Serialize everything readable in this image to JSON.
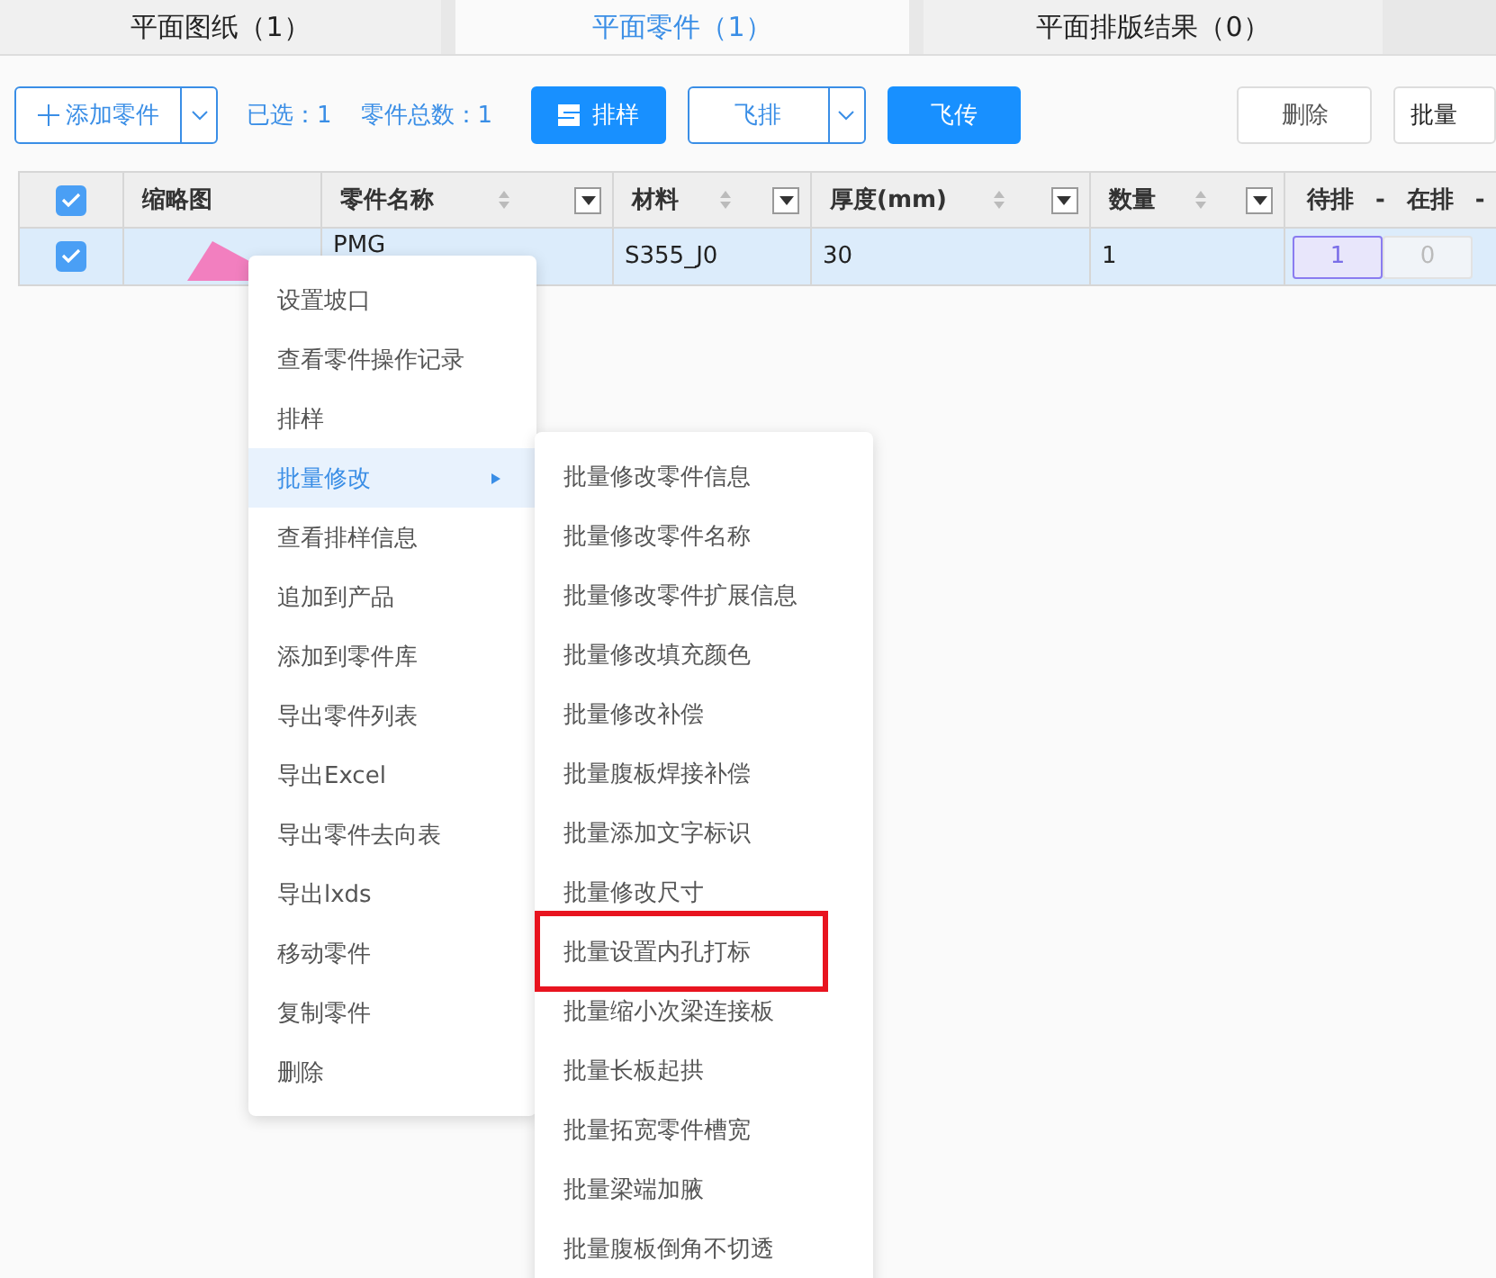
{
  "tabs": [
    {
      "label": "平面图纸（1）",
      "selected": false
    },
    {
      "label": "平面零件（1）",
      "selected": true
    },
    {
      "label": "平面排版结果（0）",
      "selected": false
    }
  ],
  "toolbar": {
    "add_part": "添加零件",
    "selected_count": "已选：1",
    "total_count": "零件总数：1",
    "nest": "排样",
    "fly_nest": "飞排",
    "fly_send": "飞传",
    "delete": "删除",
    "batch": "批量"
  },
  "table": {
    "header_checked": true,
    "columns": [
      {
        "label": "缩略图",
        "sortable": false
      },
      {
        "label": "零件名称",
        "sortable": true
      },
      {
        "label": "材料",
        "sortable": true
      },
      {
        "label": "厚度(mm)",
        "sortable": true
      },
      {
        "label": "数量",
        "sortable": true
      }
    ],
    "status_columns": [
      "待排",
      "-",
      "在排",
      "-"
    ],
    "rows": [
      {
        "checked": true,
        "selected": true,
        "name": "PMG",
        "material": "S355_J0",
        "thickness": "30",
        "quantity": "1",
        "pending": "1",
        "in_progress": "0"
      }
    ]
  },
  "context_menu": [
    {
      "label": "设置坡口",
      "selected": false,
      "submenu": false
    },
    {
      "label": "查看零件操作记录",
      "selected": false,
      "submenu": false
    },
    {
      "label": "排样",
      "selected": false,
      "submenu": false
    },
    {
      "label": "批量修改",
      "selected": true,
      "submenu": true
    },
    {
      "label": "查看排样信息",
      "selected": false,
      "submenu": false
    },
    {
      "label": "追加到产品",
      "selected": false,
      "submenu": false
    },
    {
      "label": "添加到零件库",
      "selected": false,
      "submenu": false
    },
    {
      "label": "导出零件列表",
      "selected": false,
      "submenu": false
    },
    {
      "label": "导出Excel",
      "selected": false,
      "submenu": false
    },
    {
      "label": "导出零件去向表",
      "selected": false,
      "submenu": false
    },
    {
      "label": "导出lxds",
      "selected": false,
      "submenu": false
    },
    {
      "label": "移动零件",
      "selected": false,
      "submenu": false
    },
    {
      "label": "复制零件",
      "selected": false,
      "submenu": false
    },
    {
      "label": "删除",
      "selected": false,
      "submenu": false
    }
  ],
  "submenu": [
    {
      "label": "批量修改零件信息",
      "highlighted": false
    },
    {
      "label": "批量修改零件名称",
      "highlighted": false
    },
    {
      "label": "批量修改零件扩展信息",
      "highlighted": false
    },
    {
      "label": "批量修改填充颜色",
      "highlighted": false
    },
    {
      "label": "批量修改补偿",
      "highlighted": false
    },
    {
      "label": "批量腹板焊接补偿",
      "highlighted": false
    },
    {
      "label": "批量添加文字标识",
      "highlighted": false
    },
    {
      "label": "批量修改尺寸",
      "highlighted": false
    },
    {
      "label": "批量设置内孔打标",
      "highlighted": true
    },
    {
      "label": "批量缩小次梁连接板",
      "highlighted": false
    },
    {
      "label": "批量长板起拱",
      "highlighted": false
    },
    {
      "label": "批量拓宽零件槽宽",
      "highlighted": false
    },
    {
      "label": "批量梁端加腋",
      "highlighted": false
    },
    {
      "label": "批量腹板倒角不切透",
      "highlighted": false
    }
  ]
}
